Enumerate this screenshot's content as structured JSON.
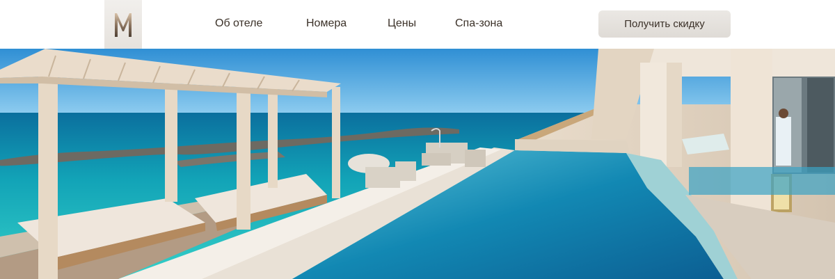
{
  "header": {
    "logo_icon": "monogram-m-logo",
    "nav": [
      {
        "label": "Об отеле"
      },
      {
        "label": "Номера"
      },
      {
        "label": "Цены"
      },
      {
        "label": "Спа-зона"
      }
    ],
    "cta_label": "Получить скидку"
  },
  "hero": {
    "image": "ocean-villa-pool-photo"
  },
  "colors": {
    "text": "#3b3128",
    "button_bg": "#e4e0dc",
    "sea": "#1aa6b5",
    "sky": "#3da4e0"
  }
}
